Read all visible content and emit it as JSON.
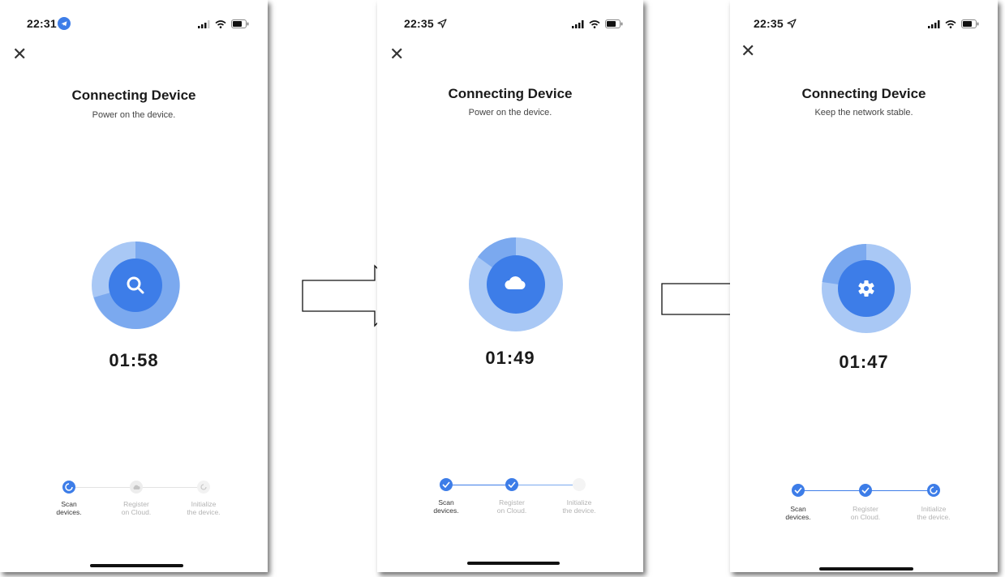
{
  "screens": [
    {
      "time": "22:31",
      "title": "Connecting Device",
      "subtitle": "Power on the device.",
      "timer": "01:58",
      "center_icon": "search-icon",
      "steps": [
        {
          "label1": "Scan",
          "label2": "devices.",
          "state": "in-progress"
        },
        {
          "label1": "Register",
          "label2": "on Cloud.",
          "state": "pending"
        },
        {
          "label1": "Initialize",
          "label2": "the device.",
          "state": "pending"
        }
      ]
    },
    {
      "time": "22:35",
      "title": "Connecting Device",
      "subtitle": "Power on the device.",
      "timer": "01:49",
      "center_icon": "cloud-icon",
      "steps": [
        {
          "label1": "Scan",
          "label2": "devices.",
          "state": "done"
        },
        {
          "label1": "Register",
          "label2": "on Cloud.",
          "state": "done"
        },
        {
          "label1": "Initialize",
          "label2": "the device.",
          "state": "pending"
        }
      ]
    },
    {
      "time": "22:35",
      "title": "Connecting Device",
      "subtitle": "Keep the network stable.",
      "timer": "01:47",
      "center_icon": "gear-icon",
      "steps": [
        {
          "label1": "Scan",
          "label2": "devices.",
          "state": "done"
        },
        {
          "label1": "Register",
          "label2": "on Cloud.",
          "state": "done"
        },
        {
          "label1": "Initialize",
          "label2": "the device.",
          "state": "in-progress"
        }
      ]
    }
  ],
  "colors": {
    "accent": "#3d7de8",
    "ring_light": "#a9c8f5",
    "ring_mid": "#7ba9ef",
    "pending": "#d9d9d9",
    "label_inactive": "#b3b3b3"
  }
}
